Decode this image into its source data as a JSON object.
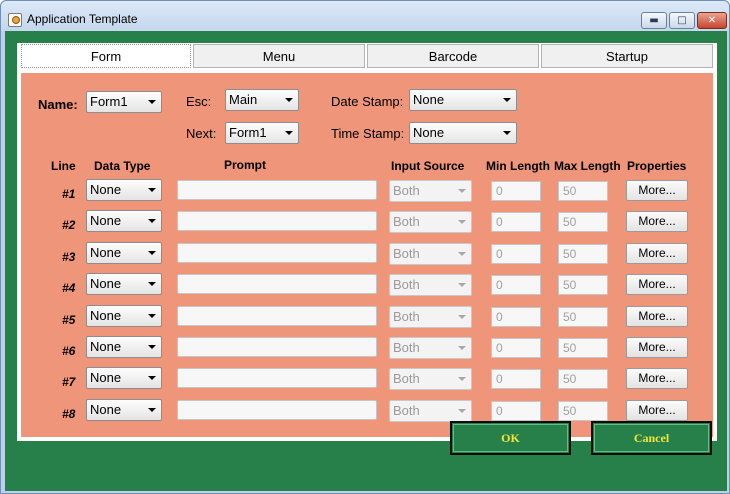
{
  "window": {
    "title": "Application Template",
    "minimize_symbol": "▬",
    "maximize_symbol": "□",
    "close_symbol": "✕"
  },
  "tabs": [
    {
      "label": "Form",
      "active": true
    },
    {
      "label": "Menu",
      "active": false
    },
    {
      "label": "Barcode",
      "active": false
    },
    {
      "label": "Startup",
      "active": false
    }
  ],
  "form": {
    "name_label": "Name:",
    "name_value": "Form1",
    "esc_label": "Esc:",
    "esc_value": "Main",
    "next_label": "Next:",
    "next_value": "Form1",
    "date_stamp_label": "Date Stamp:",
    "date_stamp_value": "None",
    "time_stamp_label": "Time Stamp:",
    "time_stamp_value": "None"
  },
  "table": {
    "headers": {
      "line": "Line",
      "data_type": "Data Type",
      "prompt": "Prompt",
      "input_source": "Input Source",
      "min_length": "Min Length",
      "max_length": "Max Length",
      "properties": "Properties"
    },
    "rows": [
      {
        "line": "#1",
        "data_type": "None",
        "prompt": "",
        "input_source": "Both",
        "min_length": "0",
        "max_length": "50",
        "properties": "More..."
      },
      {
        "line": "#2",
        "data_type": "None",
        "prompt": "",
        "input_source": "Both",
        "min_length": "0",
        "max_length": "50",
        "properties": "More..."
      },
      {
        "line": "#3",
        "data_type": "None",
        "prompt": "",
        "input_source": "Both",
        "min_length": "0",
        "max_length": "50",
        "properties": "More..."
      },
      {
        "line": "#4",
        "data_type": "None",
        "prompt": "",
        "input_source": "Both",
        "min_length": "0",
        "max_length": "50",
        "properties": "More..."
      },
      {
        "line": "#5",
        "data_type": "None",
        "prompt": "",
        "input_source": "Both",
        "min_length": "0",
        "max_length": "50",
        "properties": "More..."
      },
      {
        "line": "#6",
        "data_type": "None",
        "prompt": "",
        "input_source": "Both",
        "min_length": "0",
        "max_length": "50",
        "properties": "More..."
      },
      {
        "line": "#7",
        "data_type": "None",
        "prompt": "",
        "input_source": "Both",
        "min_length": "0",
        "max_length": "50",
        "properties": "More..."
      },
      {
        "line": "#8",
        "data_type": "None",
        "prompt": "",
        "input_source": "Both",
        "min_length": "0",
        "max_length": "50",
        "properties": "More..."
      }
    ]
  },
  "buttons": {
    "ok": "OK",
    "cancel": "Cancel"
  },
  "colors": {
    "background_green": "#278049",
    "panel_salmon": "#ee957a",
    "button_text_yellow": "#f3e63a"
  }
}
